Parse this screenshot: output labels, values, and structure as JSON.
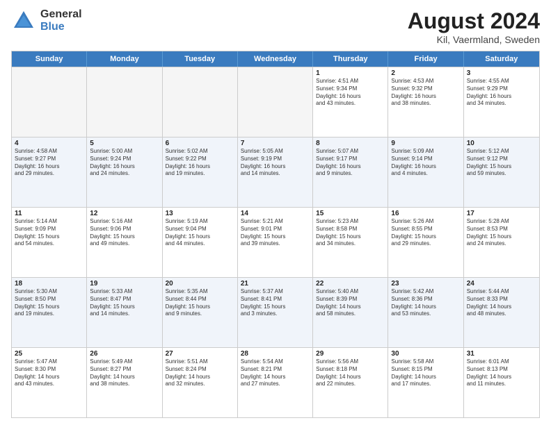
{
  "logo": {
    "general": "General",
    "blue": "Blue"
  },
  "header": {
    "title": "August 2024",
    "subtitle": "Kil, Vaermland, Sweden"
  },
  "weekdays": [
    "Sunday",
    "Monday",
    "Tuesday",
    "Wednesday",
    "Thursday",
    "Friday",
    "Saturday"
  ],
  "rows": [
    [
      {
        "day": "",
        "info": "",
        "empty": true
      },
      {
        "day": "",
        "info": "",
        "empty": true
      },
      {
        "day": "",
        "info": "",
        "empty": true
      },
      {
        "day": "",
        "info": "",
        "empty": true
      },
      {
        "day": "1",
        "info": "Sunrise: 4:51 AM\nSunset: 9:34 PM\nDaylight: 16 hours\nand 43 minutes.",
        "empty": false
      },
      {
        "day": "2",
        "info": "Sunrise: 4:53 AM\nSunset: 9:32 PM\nDaylight: 16 hours\nand 38 minutes.",
        "empty": false
      },
      {
        "day": "3",
        "info": "Sunrise: 4:55 AM\nSunset: 9:29 PM\nDaylight: 16 hours\nand 34 minutes.",
        "empty": false
      }
    ],
    [
      {
        "day": "4",
        "info": "Sunrise: 4:58 AM\nSunset: 9:27 PM\nDaylight: 16 hours\nand 29 minutes.",
        "empty": false
      },
      {
        "day": "5",
        "info": "Sunrise: 5:00 AM\nSunset: 9:24 PM\nDaylight: 16 hours\nand 24 minutes.",
        "empty": false
      },
      {
        "day": "6",
        "info": "Sunrise: 5:02 AM\nSunset: 9:22 PM\nDaylight: 16 hours\nand 19 minutes.",
        "empty": false
      },
      {
        "day": "7",
        "info": "Sunrise: 5:05 AM\nSunset: 9:19 PM\nDaylight: 16 hours\nand 14 minutes.",
        "empty": false
      },
      {
        "day": "8",
        "info": "Sunrise: 5:07 AM\nSunset: 9:17 PM\nDaylight: 16 hours\nand 9 minutes.",
        "empty": false
      },
      {
        "day": "9",
        "info": "Sunrise: 5:09 AM\nSunset: 9:14 PM\nDaylight: 16 hours\nand 4 minutes.",
        "empty": false
      },
      {
        "day": "10",
        "info": "Sunrise: 5:12 AM\nSunset: 9:12 PM\nDaylight: 15 hours\nand 59 minutes.",
        "empty": false
      }
    ],
    [
      {
        "day": "11",
        "info": "Sunrise: 5:14 AM\nSunset: 9:09 PM\nDaylight: 15 hours\nand 54 minutes.",
        "empty": false
      },
      {
        "day": "12",
        "info": "Sunrise: 5:16 AM\nSunset: 9:06 PM\nDaylight: 15 hours\nand 49 minutes.",
        "empty": false
      },
      {
        "day": "13",
        "info": "Sunrise: 5:19 AM\nSunset: 9:04 PM\nDaylight: 15 hours\nand 44 minutes.",
        "empty": false
      },
      {
        "day": "14",
        "info": "Sunrise: 5:21 AM\nSunset: 9:01 PM\nDaylight: 15 hours\nand 39 minutes.",
        "empty": false
      },
      {
        "day": "15",
        "info": "Sunrise: 5:23 AM\nSunset: 8:58 PM\nDaylight: 15 hours\nand 34 minutes.",
        "empty": false
      },
      {
        "day": "16",
        "info": "Sunrise: 5:26 AM\nSunset: 8:55 PM\nDaylight: 15 hours\nand 29 minutes.",
        "empty": false
      },
      {
        "day": "17",
        "info": "Sunrise: 5:28 AM\nSunset: 8:53 PM\nDaylight: 15 hours\nand 24 minutes.",
        "empty": false
      }
    ],
    [
      {
        "day": "18",
        "info": "Sunrise: 5:30 AM\nSunset: 8:50 PM\nDaylight: 15 hours\nand 19 minutes.",
        "empty": false
      },
      {
        "day": "19",
        "info": "Sunrise: 5:33 AM\nSunset: 8:47 PM\nDaylight: 15 hours\nand 14 minutes.",
        "empty": false
      },
      {
        "day": "20",
        "info": "Sunrise: 5:35 AM\nSunset: 8:44 PM\nDaylight: 15 hours\nand 9 minutes.",
        "empty": false
      },
      {
        "day": "21",
        "info": "Sunrise: 5:37 AM\nSunset: 8:41 PM\nDaylight: 15 hours\nand 3 minutes.",
        "empty": false
      },
      {
        "day": "22",
        "info": "Sunrise: 5:40 AM\nSunset: 8:39 PM\nDaylight: 14 hours\nand 58 minutes.",
        "empty": false
      },
      {
        "day": "23",
        "info": "Sunrise: 5:42 AM\nSunset: 8:36 PM\nDaylight: 14 hours\nand 53 minutes.",
        "empty": false
      },
      {
        "day": "24",
        "info": "Sunrise: 5:44 AM\nSunset: 8:33 PM\nDaylight: 14 hours\nand 48 minutes.",
        "empty": false
      }
    ],
    [
      {
        "day": "25",
        "info": "Sunrise: 5:47 AM\nSunset: 8:30 PM\nDaylight: 14 hours\nand 43 minutes.",
        "empty": false
      },
      {
        "day": "26",
        "info": "Sunrise: 5:49 AM\nSunset: 8:27 PM\nDaylight: 14 hours\nand 38 minutes.",
        "empty": false
      },
      {
        "day": "27",
        "info": "Sunrise: 5:51 AM\nSunset: 8:24 PM\nDaylight: 14 hours\nand 32 minutes.",
        "empty": false
      },
      {
        "day": "28",
        "info": "Sunrise: 5:54 AM\nSunset: 8:21 PM\nDaylight: 14 hours\nand 27 minutes.",
        "empty": false
      },
      {
        "day": "29",
        "info": "Sunrise: 5:56 AM\nSunset: 8:18 PM\nDaylight: 14 hours\nand 22 minutes.",
        "empty": false
      },
      {
        "day": "30",
        "info": "Sunrise: 5:58 AM\nSunset: 8:15 PM\nDaylight: 14 hours\nand 17 minutes.",
        "empty": false
      },
      {
        "day": "31",
        "info": "Sunrise: 6:01 AM\nSunset: 8:13 PM\nDaylight: 14 hours\nand 11 minutes.",
        "empty": false
      }
    ]
  ],
  "altRows": [
    1,
    3
  ]
}
